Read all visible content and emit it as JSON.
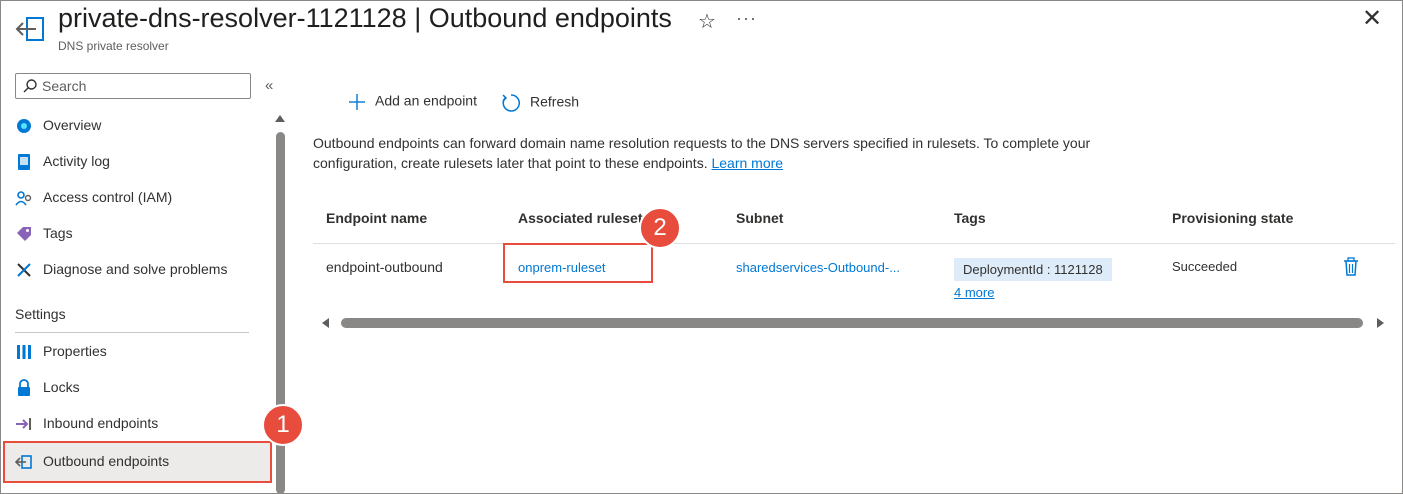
{
  "header": {
    "resource_name": "private-dns-resolver-1121128",
    "separator": "|",
    "page_name": "Outbound endpoints",
    "subtitle": "DNS private resolver",
    "favorite_icon": "☆",
    "more_icon": "···",
    "close_icon": "✕"
  },
  "sidebar": {
    "search_placeholder": "Search",
    "collapse_icon": "«",
    "items": [
      {
        "label": "Overview",
        "icon": "overview-icon"
      },
      {
        "label": "Activity log",
        "icon": "activity-log-icon"
      },
      {
        "label": "Access control (IAM)",
        "icon": "iam-icon"
      },
      {
        "label": "Tags",
        "icon": "tag-icon"
      },
      {
        "label": "Diagnose and solve problems",
        "icon": "wrench-icon"
      }
    ],
    "section_settings": "Settings",
    "settings_items": [
      {
        "label": "Properties",
        "icon": "properties-icon"
      },
      {
        "label": "Locks",
        "icon": "lock-icon"
      },
      {
        "label": "Inbound endpoints",
        "icon": "inbound-icon"
      },
      {
        "label": "Outbound endpoints",
        "icon": "outbound-icon",
        "selected": true
      }
    ]
  },
  "toolbar": {
    "add_label": "Add an endpoint",
    "refresh_label": "Refresh"
  },
  "description": {
    "text": "Outbound endpoints can forward domain name resolution requests to the DNS servers specified in rulesets. To complete your configuration, create rulesets later that point to these endpoints.",
    "learn_more": "Learn more"
  },
  "table": {
    "columns": [
      "Endpoint name",
      "Associated ruleset",
      "Subnet",
      "Tags",
      "Provisioning state"
    ],
    "rows": [
      {
        "endpoint_name": "endpoint-outbound",
        "associated_ruleset": "onprem-ruleset",
        "subnet": "sharedservices-Outbound-...",
        "tag": "DeploymentId : 1121128",
        "more_tags": "4 more",
        "provisioning_state": "Succeeded"
      }
    ]
  },
  "callouts": {
    "badge_1": "1",
    "badge_2": "2"
  },
  "colors": {
    "accent": "#0078d4",
    "callout": "#e74c3c",
    "tag_chip": "#deecf9",
    "selected_bg": "#edebe9"
  }
}
